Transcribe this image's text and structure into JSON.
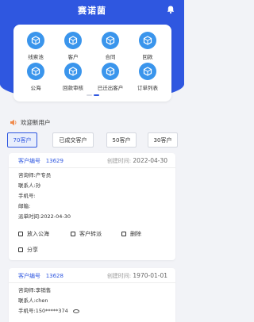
{
  "header": {
    "title": "赛诺菌",
    "bell_icon": "bell-icon"
  },
  "menu": {
    "items": [
      {
        "label": "线索池",
        "icon": "cube-icon"
      },
      {
        "label": "客户",
        "icon": "cube-icon"
      },
      {
        "label": "合同",
        "icon": "cube-icon"
      },
      {
        "label": "回款",
        "icon": "cube-icon"
      },
      {
        "label": "公海",
        "icon": "cube-icon"
      },
      {
        "label": "回款审核",
        "icon": "cube-icon"
      },
      {
        "label": "已迁出客户",
        "icon": "cube-icon"
      },
      {
        "label": "订单列表",
        "icon": "cube-icon"
      }
    ],
    "icon_color": "#3a95ec"
  },
  "notice": {
    "text": "欢迎新用户",
    "icon": "speaker-icon"
  },
  "tabs": [
    {
      "label": "70客户",
      "active": true
    },
    {
      "label": "已成交客户",
      "active": false
    },
    {
      "label": "50客户",
      "active": false
    },
    {
      "label": "30客户",
      "active": false
    }
  ],
  "cards": [
    {
      "customer_no_label": "客户编号",
      "customer_no": "13629",
      "created_label": "创建时间:",
      "created": "2022-04-30",
      "consultant": "咨询师:产专员",
      "contact": "联系人:孙",
      "phone": "手机号:",
      "email": "邮箱:",
      "dispatch_time": "派单时间:2022-04-30",
      "actions": {
        "put_public": "放入公海",
        "transfer": "客户转派",
        "delete": "删除",
        "share": "分享"
      }
    },
    {
      "customer_no_label": "客户编号",
      "customer_no": "13628",
      "created_label": "创建时间:",
      "created": "1970-01-01",
      "consultant": "咨询师:李销售",
      "contact": "联系人:chen",
      "phone": "手机号:150*****374"
    }
  ],
  "colors": {
    "brand": "#2f57e0",
    "background": "#f2f3f7"
  }
}
